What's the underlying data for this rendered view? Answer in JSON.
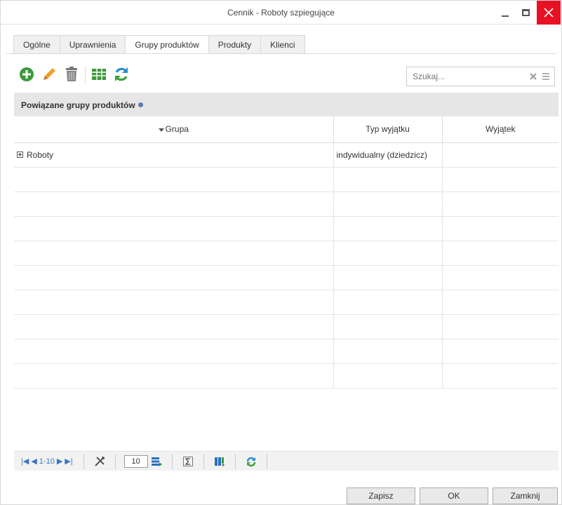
{
  "window": {
    "title": "Cennik - Roboty szpiegujące"
  },
  "tabs": [
    {
      "label": "Ogólne",
      "active": false
    },
    {
      "label": "Uprawnienia",
      "active": false
    },
    {
      "label": "Grupy produktów",
      "active": true
    },
    {
      "label": "Produkty",
      "active": false
    },
    {
      "label": "Klienci",
      "active": false
    }
  ],
  "toolbar": {
    "icons": [
      "add-icon",
      "edit-icon",
      "delete-icon",
      "table-icon",
      "refresh-icon"
    ],
    "colors": {
      "add": "#3c9a3c",
      "edit": "#f0a030",
      "delete": "#777777",
      "table": "#3a9a3a",
      "refresh": "#2a8fd0"
    }
  },
  "search": {
    "placeholder": "Szukaj...",
    "value": ""
  },
  "panel": {
    "title": "Powiązane grupy produktów"
  },
  "grid": {
    "columns": [
      {
        "label": "Grupa",
        "sorted": "desc"
      },
      {
        "label": "Typ wyjątku"
      },
      {
        "label": "Wyjątek"
      }
    ],
    "rows": [
      {
        "grupa": "Roboty",
        "typ": "indywidualny (dziedzicz)",
        "wyjatek": ""
      }
    ]
  },
  "pager": {
    "range": "1-10",
    "page_size": "10"
  },
  "buttons": {
    "save": "Zapisz",
    "ok": "OK",
    "close": "Zamknij"
  },
  "colors": {
    "close_button_bg": "#e81123",
    "panel_header_bg": "#e6e6e6",
    "pager_accent": "#3a76c4"
  }
}
